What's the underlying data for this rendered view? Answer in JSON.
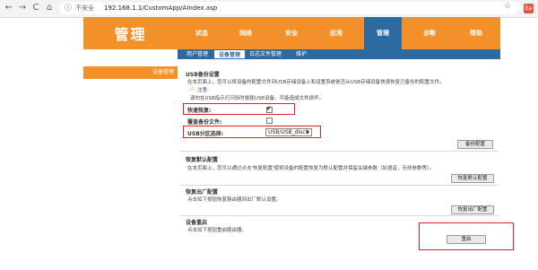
{
  "browser": {
    "back": "←",
    "forward": "→",
    "reload": "C",
    "home": "⌂",
    "security_label": "不安全",
    "url": "192.168.1.1/CustomApp/AIndex.asp",
    "ext_label": "Ea"
  },
  "router": {
    "logo": "管理",
    "tabs": [
      "状态",
      "网络",
      "安全",
      "应用",
      "管理",
      "诊断",
      "帮助"
    ],
    "active_tab": "管理",
    "subnav": [
      "用户管理",
      "设备管理",
      "日志文件管理",
      "维护"
    ],
    "active_subnav": "设备管理",
    "sidebar_item": "设备管理"
  },
  "usb_backup": {
    "title": "USB备份设置",
    "desc": "在本页面上，您可以将设备的配置文件到USB存储设备上和设置系统是否从USB存储设备快速恢复已备份的配置文件。",
    "note_label": "注意:",
    "note_text": "请勿在USB指示灯闪烁时拔插USB设备，可能造成文件损坏。",
    "quick_restore_label": "快速恢复:",
    "quick_restore_checked": true,
    "overwrite_label": "覆盖备份文件:",
    "overwrite_checked": false,
    "partition_label": "USB分区选择:",
    "partition_value": "USB/USB_disc1",
    "backup_button": "备份配置"
  },
  "restore_default": {
    "title": "恢复默认配置",
    "desc": "在本页面上，您可以通过点击'恢复配置'使将设备的配置恢复为默认配置并保留关键参数（如语音，无线参数等）。",
    "button": "恢复默认配置"
  },
  "factory": {
    "title": "恢复出厂配置",
    "desc": "点击如下按钮恢复路由器到出厂默认设置。",
    "button": "恢复出厂配置"
  },
  "reboot": {
    "title": "设备重启",
    "desc": "点击如下按钮重启路由器。",
    "button": "重启"
  },
  "colors": {
    "orange": "#f2902a",
    "blue": "#2d6a9f",
    "highlight": "#e21f26"
  }
}
